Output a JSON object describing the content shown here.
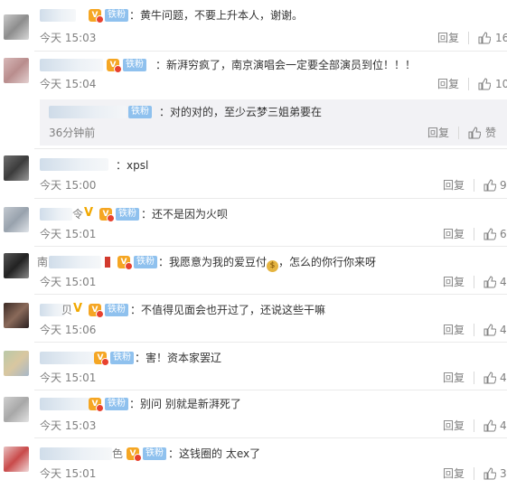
{
  "labels": {
    "reply": "回复",
    "like_sub": "赞",
    "tiefen": "铁粉"
  },
  "comments": [
    {
      "time": "今天 15:03",
      "text": "黄牛问题，不要上升本人，谢谢。",
      "likes": "16"
    },
    {
      "time": "今天 15:04",
      "text": "新湃穷疯了，南京演唱会一定要全部演员到位！！！",
      "likes": "10"
    },
    {
      "time": "今天 15:00",
      "text": "xpsl",
      "likes": "9"
    },
    {
      "time": "今天 15:01",
      "text": "还不是因为火呗",
      "likes": "6"
    },
    {
      "time": "今天 15:01",
      "text_a": "我愿意为我的爱豆付",
      "text_b": "，怎么的你行你来呀",
      "likes": "4"
    },
    {
      "time": "今天 15:06",
      "text": "不值得见面会也开过了，还说这些干嘛",
      "likes": "4"
    },
    {
      "time": "今天 15:01",
      "text": "害！资本家罢辽",
      "likes": "4"
    },
    {
      "time": "今天 15:03",
      "text": "别问 别就是新湃死了",
      "likes": "4"
    },
    {
      "time": "今天 15:01",
      "text": "这钱圈的 太ex了",
      "likes": "3"
    }
  ],
  "subreply": {
    "text": "对的对的，至少云梦三姐弟要在",
    "time": "36分钟前"
  },
  "name_fragments": {
    "c4": "令",
    "c5": "贝",
    "c6": "南",
    "c9": "色"
  },
  "colors": {
    "tiefen_bg": "#8fc1ee",
    "vip_orange": "#f5a623",
    "divider": "#eaeaea",
    "subbox_bg": "#f2f2f5"
  }
}
